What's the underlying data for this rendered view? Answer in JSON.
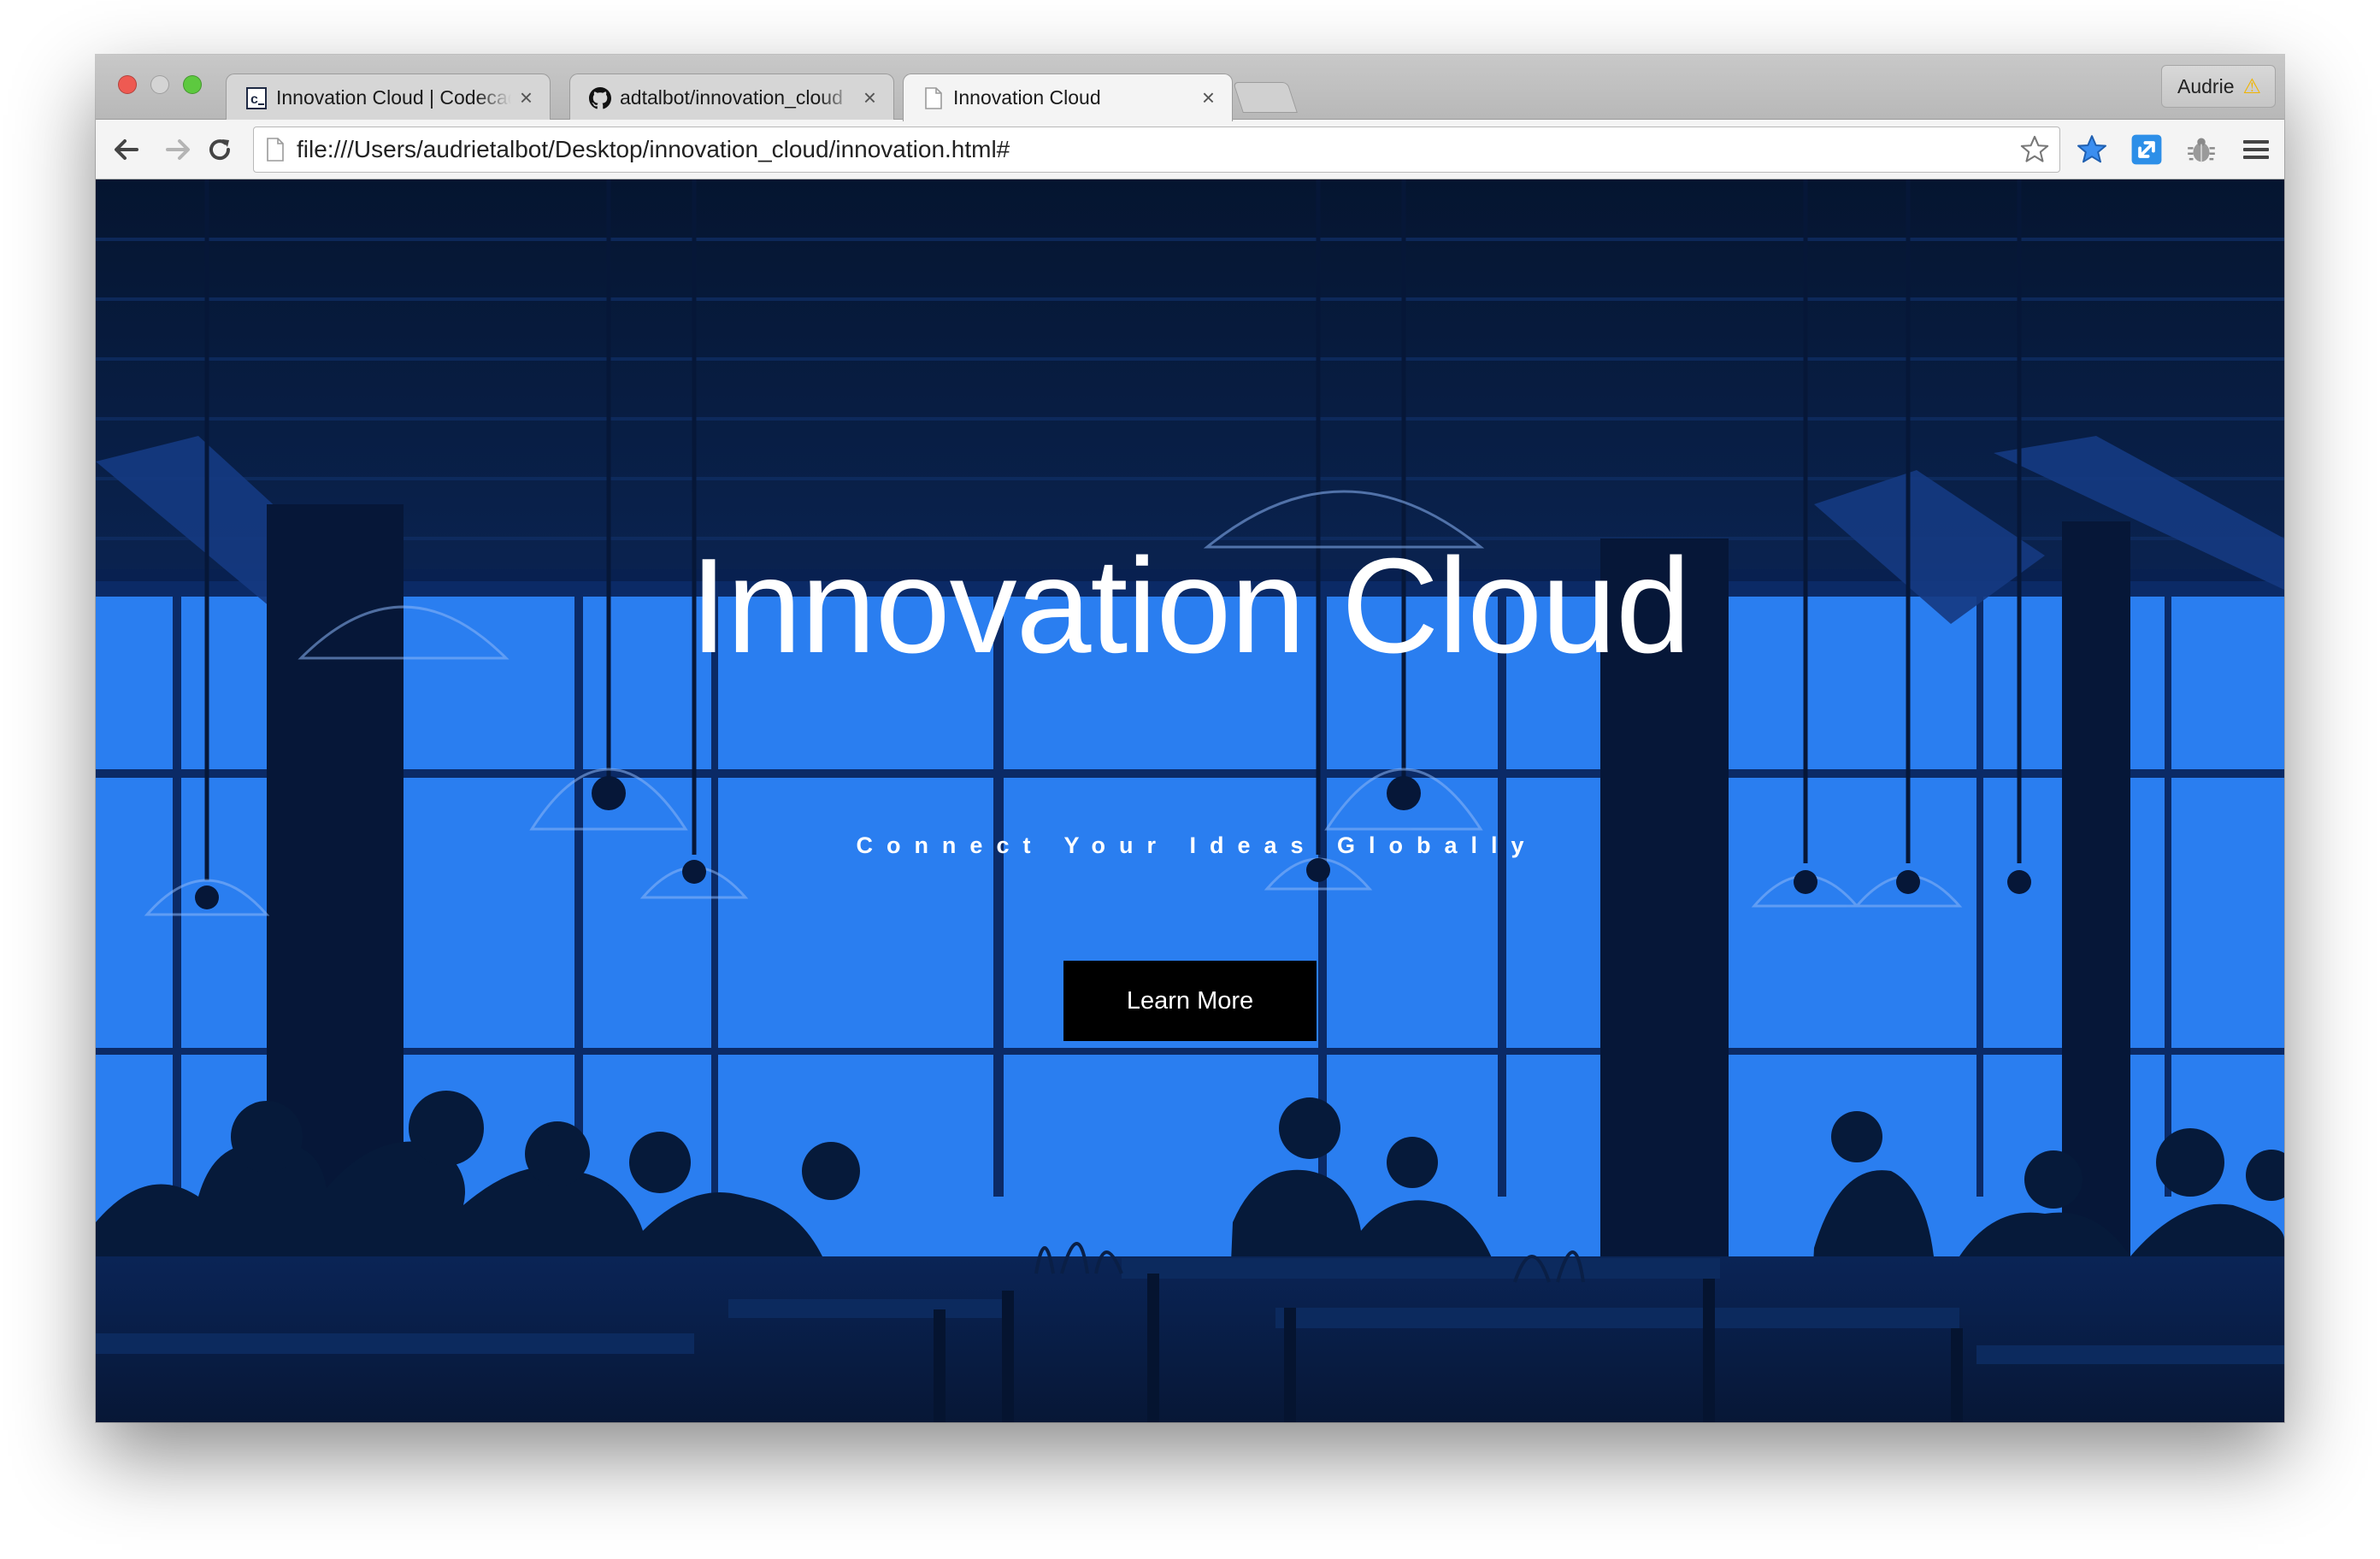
{
  "browser": {
    "tabs": [
      {
        "title": "Innovation Cloud | Codecademy",
        "favicon": "codecademy-icon",
        "active": false
      },
      {
        "title": "adtalbot/innovation_cloud",
        "favicon": "github-icon",
        "active": false
      },
      {
        "title": "Innovation Cloud",
        "favicon": "page-icon",
        "active": true
      }
    ],
    "tab_close_glyph": "×",
    "url": "file:///Users/audrietalbot/Desktop/innovation_cloud/innovation.html#",
    "profile_name": "Audrie",
    "profile_warning_glyph": "⚠"
  },
  "hero": {
    "title": "Innovation Cloud",
    "subtitle": "Connect Your Ideas Globally",
    "button_label": "Learn More"
  },
  "colors": {
    "hero_blue": "#2a7ef0",
    "hero_dark": "#061a3a",
    "button_bg": "#000000"
  }
}
